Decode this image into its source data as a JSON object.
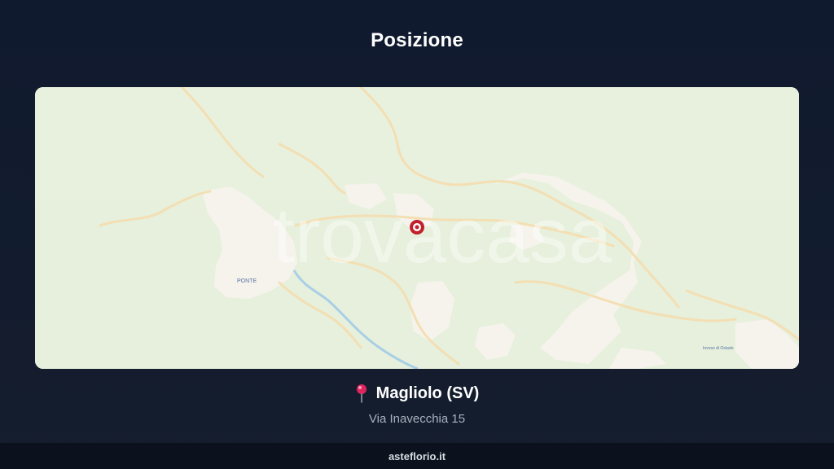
{
  "header": {
    "title": "Posizione"
  },
  "map": {
    "watermark": "trovacasa",
    "labels": {
      "ponte": "PONTE",
      "locality": "Invoso di Ostado"
    },
    "marker_icon": "location-marker-icon",
    "colors": {
      "land": "#e6f0dc",
      "urban": "#f6f3ec",
      "road": "#f3dfb3",
      "river": "#a9cfe6",
      "marker": "#c0212b"
    }
  },
  "location": {
    "pin_icon": "round-pushpin-icon",
    "city": "Magliolo (SV)",
    "street": "Via Inavecchia 15"
  },
  "footer": {
    "brand": "asteflorio.it"
  }
}
